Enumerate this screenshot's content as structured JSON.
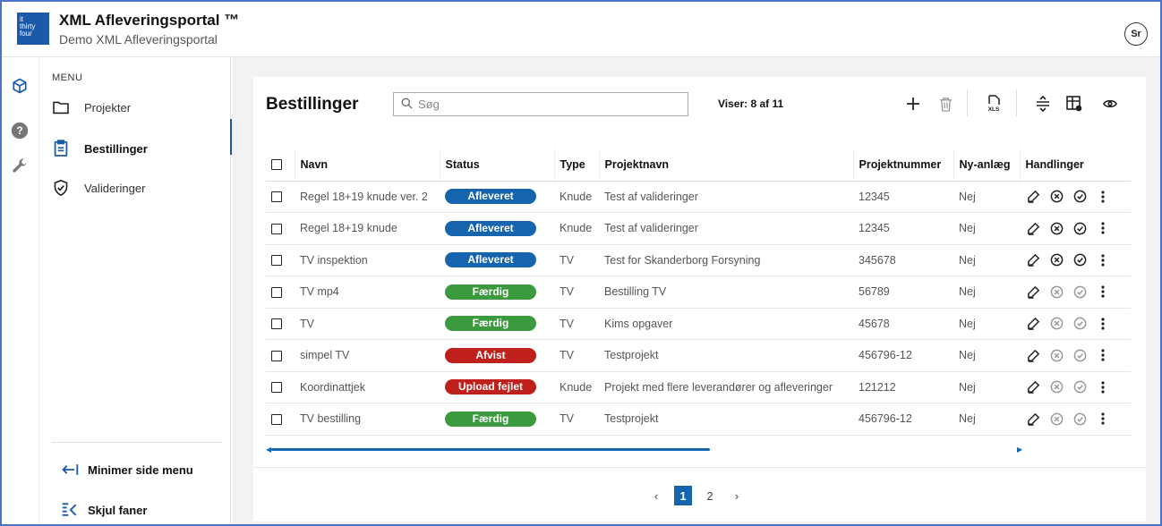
{
  "header": {
    "logo_lines": [
      "it",
      "thirty",
      "four"
    ],
    "title": "XML Afleveringsportal ™",
    "subtitle": "Demo XML Afleveringsportal",
    "user_initials": "Sr"
  },
  "rail": {
    "icons": [
      "cube-icon",
      "help-icon",
      "wrench-icon"
    ]
  },
  "sidebar": {
    "heading": "MENU",
    "items": [
      {
        "label": "Projekter",
        "icon": "folder-icon"
      },
      {
        "label": "Bestillinger",
        "icon": "clipboard-icon",
        "active": true
      },
      {
        "label": "Valideringer",
        "icon": "shield-check-icon"
      }
    ],
    "collapse_glyph": "‹",
    "footer": {
      "minimize": "Minimer side menu",
      "hide_tabs": "Skjul faner"
    }
  },
  "main": {
    "title": "Bestillinger",
    "search_placeholder": "Søg",
    "count_text": "Viser: 8 af 11",
    "columns": [
      "Navn",
      "Status",
      "Type",
      "Projektnavn",
      "Projektnummer",
      "Ny-anlæg",
      "Handlinger"
    ],
    "rows": [
      {
        "navn": "Regel 18+19 knude ver. 2",
        "status": "Afleveret",
        "status_color": "#1664ae",
        "type": "Knude",
        "projektnavn": "Test af valideringer",
        "projektnummer": "12345",
        "nyanlaeg": "Nej",
        "actions_enabled": true
      },
      {
        "navn": "Regel 18+19 knude",
        "status": "Afleveret",
        "status_color": "#1664ae",
        "type": "Knude",
        "projektnavn": "Test af valideringer",
        "projektnummer": "12345",
        "nyanlaeg": "Nej",
        "actions_enabled": true
      },
      {
        "navn": "TV inspektion",
        "status": "Afleveret",
        "status_color": "#1664ae",
        "type": "TV",
        "projektnavn": "Test for Skanderborg Forsyning",
        "projektnummer": "345678",
        "nyanlaeg": "Nej",
        "actions_enabled": true
      },
      {
        "navn": "TV mp4",
        "status": "Færdig",
        "status_color": "#3b9a3e",
        "type": "TV",
        "projektnavn": "Bestilling TV",
        "projektnummer": "56789",
        "nyanlaeg": "Nej",
        "actions_enabled": false
      },
      {
        "navn": "TV",
        "status": "Færdig",
        "status_color": "#3b9a3e",
        "type": "TV",
        "projektnavn": "Kims opgaver",
        "projektnummer": "45678",
        "nyanlaeg": "Nej",
        "actions_enabled": false
      },
      {
        "navn": "simpel TV",
        "status": "Afvist",
        "status_color": "#c0201c",
        "type": "TV",
        "projektnavn": "Testprojekt",
        "projektnummer": "456796-12",
        "nyanlaeg": "Nej",
        "actions_enabled": false
      },
      {
        "navn": "Koordinattjek",
        "status": "Upload fejlet",
        "status_color": "#c0201c",
        "type": "Knude",
        "projektnavn": "Projekt med flere leverandører og afleveringer",
        "projektnummer": "121212",
        "nyanlaeg": "Nej",
        "actions_enabled": false
      },
      {
        "navn": "TV bestilling",
        "status": "Færdig",
        "status_color": "#3b9a3e",
        "type": "TV",
        "projektnavn": "Testprojekt",
        "projektnummer": "456796-12",
        "nyanlaeg": "Nej",
        "actions_enabled": false
      }
    ],
    "pager": {
      "prev": "‹",
      "pages": [
        "1",
        "2"
      ],
      "current": "1",
      "next": "›"
    }
  }
}
